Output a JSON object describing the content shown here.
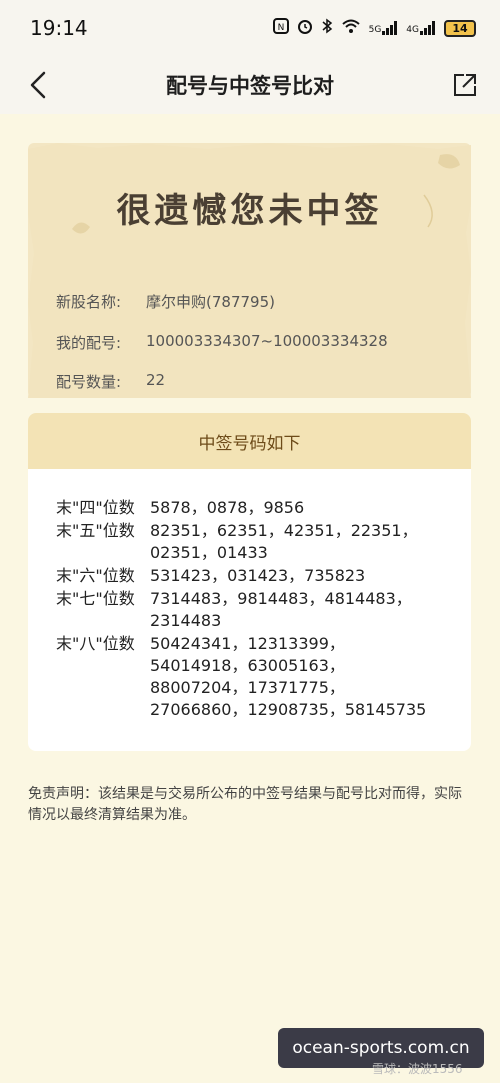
{
  "status": {
    "time": "19:14",
    "signal1": "5G",
    "signal2": "4G",
    "battery": "14"
  },
  "nav": {
    "title": "配号与中签号比对"
  },
  "result": {
    "headline": "很遗憾您未中签",
    "stock_label": "新股名称:",
    "stock_value": "摩尔申购(787795)",
    "number_label": "我的配号:",
    "number_value": "100003334307~100003334328",
    "count_label": "配号数量:",
    "count_value": "22"
  },
  "winning": {
    "header": "中签号码如下",
    "rows": [
      {
        "label": "末\"四\"位数",
        "lines": [
          "5878，0878，9856"
        ]
      },
      {
        "label": "末\"五\"位数",
        "lines": [
          "82351，62351，42351，22351，",
          "02351，01433"
        ]
      },
      {
        "label": "末\"六\"位数",
        "lines": [
          "531423，031423，735823"
        ]
      },
      {
        "label": "末\"七\"位数",
        "lines": [
          "7314483，9814483，4814483，",
          "2314483"
        ]
      },
      {
        "label": "末\"八\"位数",
        "lines": [
          "50424341，12313399，",
          "54014918，63005163，",
          "88007204，17371775，",
          "27066860，12908735，58145735"
        ]
      }
    ]
  },
  "disclaimer": "免责声明：该结果是与交易所公布的中签号结果与配号比对而得，实际情况以最终清算结果为准。",
  "watermark": "ocean-sports.com.cn",
  "credit": "雪球：波波1556",
  "colors": {
    "background": "#fbf7e2",
    "card": "#f3e6c3",
    "header_band": "#f3e3b5"
  }
}
